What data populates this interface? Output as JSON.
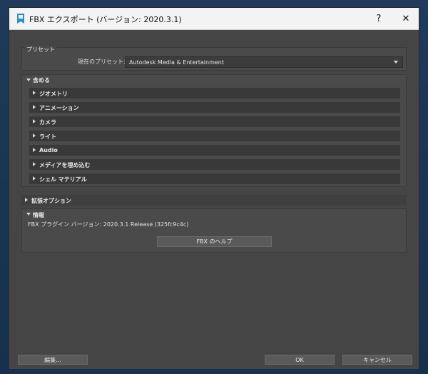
{
  "window": {
    "title": "FBX エクスポート (バージョン: 2020.3.1)",
    "help_button": "?",
    "close_button": "✕"
  },
  "preset": {
    "group_label": "プリセット",
    "current_label": "現在のプリセット:",
    "current_value": "Autodesk Media & Entertainment"
  },
  "include": {
    "label": "含める",
    "items": [
      {
        "label": "ジオメトリ"
      },
      {
        "label": "アニメーション"
      },
      {
        "label": "カメラ"
      },
      {
        "label": "ライト"
      },
      {
        "label": "Audio"
      },
      {
        "label": "メディアを埋め込む"
      },
      {
        "label": "シェル マテリアル"
      }
    ]
  },
  "advanced": {
    "label": "拡張オプション"
  },
  "info": {
    "label": "情報",
    "version_text": "FBX プラグイン バージョン: 2020.3.1 Release (325fc9c4c)",
    "help_button": "FBX のヘルプ"
  },
  "footer": {
    "edit_button": "編集...",
    "ok_button": "OK",
    "cancel_button": "キャンセル"
  }
}
